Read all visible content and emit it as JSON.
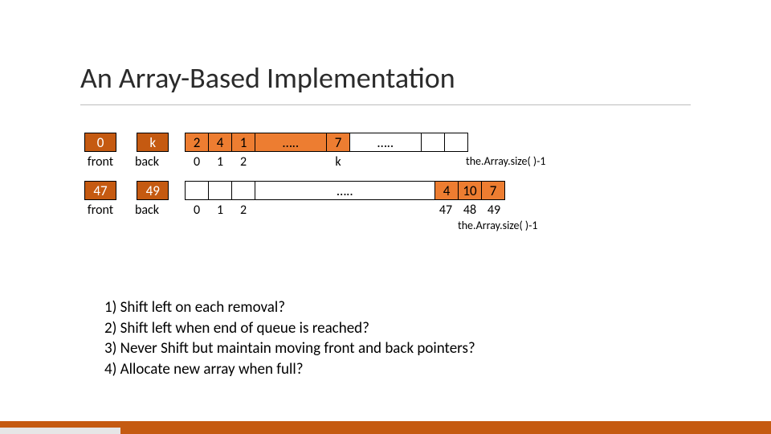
{
  "title": "An Array-Based Implementation",
  "pointer_pair1": {
    "front_val": "0",
    "back_val": "k",
    "front_lbl": "front",
    "back_lbl": "back"
  },
  "pointer_pair2": {
    "front_val": "47",
    "back_val": "49",
    "front_lbl": "front",
    "back_lbl": "back"
  },
  "array1": {
    "cells": [
      "2",
      "4",
      "1"
    ],
    "ell1": "…..",
    "mid": "7",
    "ell2": "…..",
    "idx0": "0",
    "idx1": "1",
    "idx2": "2",
    "idxk": "k",
    "size_label": "the.Array.size( )-1"
  },
  "array2": {
    "ell": "…..",
    "tail": [
      "4",
      "10",
      "7"
    ],
    "idx0": "0",
    "idx1": "1",
    "idx2": "2",
    "idx47": "47",
    "idx48": "48",
    "idx49": "49",
    "size_label": "the.Array.size( )-1"
  },
  "questions": {
    "q1": "1) Shift left on each removal?",
    "q2": "2) Shift left when end of queue is reached?",
    "q3": "3) Never Shift but maintain moving front and back pointers?",
    "q4": "4) Allocate new array when full?"
  }
}
